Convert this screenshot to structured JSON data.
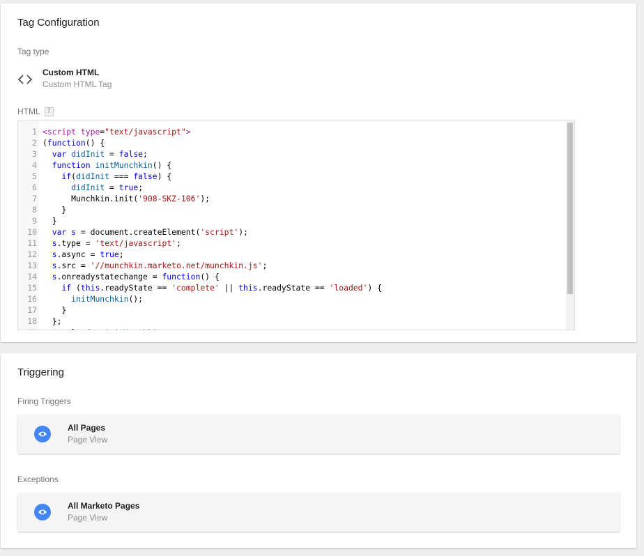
{
  "tag_config": {
    "title": "Tag Configuration",
    "tag_type_label": "Tag type",
    "tag_type_name": "Custom HTML",
    "tag_type_sub": "Custom HTML Tag",
    "html_label": "HTML",
    "help_glyph": "?",
    "code_lines": [
      "<script type=\"text/javascript\">",
      "(function() {",
      "  var didInit = false;",
      "  function initMunchkin() {",
      "    if(didInit === false) {",
      "      didInit = true;",
      "      Munchkin.init('908-SKZ-106');",
      "    }",
      "  }",
      "  var s = document.createElement('script');",
      "  s.type = 'text/javascript';",
      "  s.async = true;",
      "  s.src = '//munchkin.marketo.net/munchkin.js';",
      "  s.onreadystatechange = function() {",
      "    if (this.readyState == 'complete' || this.readyState == 'loaded') {",
      "      initMunchkin();",
      "    }",
      "  };",
      "  s.onload = initMunchkin;"
    ]
  },
  "triggering": {
    "title": "Triggering",
    "firing_label": "Firing Triggers",
    "firing": {
      "name": "All Pages",
      "sub": "Page View"
    },
    "exceptions_label": "Exceptions",
    "exception": {
      "name": "All Marketo Pages",
      "sub": "Page View"
    }
  },
  "icons": {
    "tag_type": "code-brackets-icon",
    "trigger": "eye-icon",
    "help": "help-icon"
  },
  "colors": {
    "trigger_icon": "#4285f4"
  }
}
